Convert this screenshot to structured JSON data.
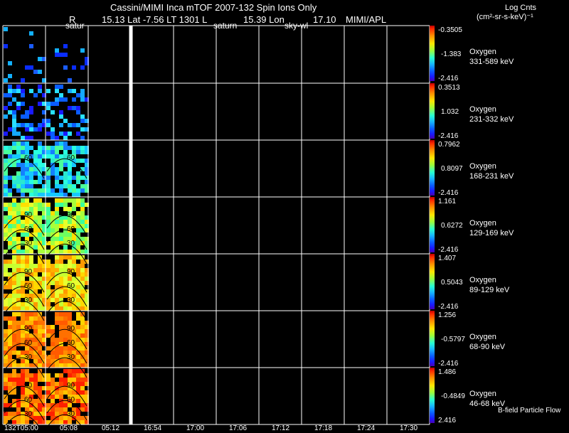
{
  "header": {
    "title_line": "Cassini/MIMI Inca mTOF  2007-132   Spin    Ions Only",
    "r_label": "R",
    "lat_text": "15.13 Lat -7.56 LT 1301 L",
    "lon_text": "15.39 Lon",
    "l_value": "17.10",
    "credit": "MIMI/APL",
    "units_line1": "Log Cnts",
    "units_line2": "(cm²-sr-s-keV)⁻¹"
  },
  "column_labels": [
    "satur",
    "saturn",
    "sky-wl"
  ],
  "time_axis": {
    "labels": [
      "132T05:00",
      "05:08",
      "05:12",
      "16:54",
      "17:00",
      "17:06",
      "17:12",
      "17:18",
      "17:24",
      "17:30"
    ]
  },
  "panels": [
    {
      "species": "Oxygen",
      "energy": "331-589 keV",
      "cb_max": "-0.3505",
      "cb_mid": "-1.383",
      "cb_min": "-2.416",
      "contours": []
    },
    {
      "species": "Oxygen",
      "energy": "231-332 keV",
      "cb_max": "0.3513",
      "cb_mid": "1.032",
      "cb_min": "-2.416",
      "contours": []
    },
    {
      "species": "Oxygen",
      "energy": "168-231 keV",
      "cb_max": "0.7962",
      "cb_mid": "0.8097",
      "cb_min": "-2.416",
      "contours": [
        "60"
      ]
    },
    {
      "species": "Oxygen",
      "energy": "129-169 keV",
      "cb_max": "1.161",
      "cb_mid": "0.6272",
      "cb_min": "-2.416",
      "contours": [
        "90",
        "60",
        "30"
      ]
    },
    {
      "species": "Oxygen",
      "energy": "89-129 keV",
      "cb_max": "1.407",
      "cb_mid": "0.5043",
      "cb_min": "-2.416",
      "contours": [
        "90",
        "60",
        "30"
      ]
    },
    {
      "species": "Oxygen",
      "energy": "68-90 keV",
      "cb_max": "1.256",
      "cb_mid": "-0.5797",
      "cb_min": "-2.416",
      "contours": [
        "90",
        "60",
        "30"
      ]
    },
    {
      "species": "Oxygen",
      "energy": "46-68 keV",
      "cb_max": "1.486",
      "cb_mid": "-0.4849",
      "cb_min": "2.416",
      "contours": [
        "90",
        "60",
        "30"
      ]
    }
  ],
  "footer_note": "B-field Particle Flow",
  "colors": {
    "background": "#000000",
    "grid": "#ffffff",
    "marker": "#ffffff"
  }
}
